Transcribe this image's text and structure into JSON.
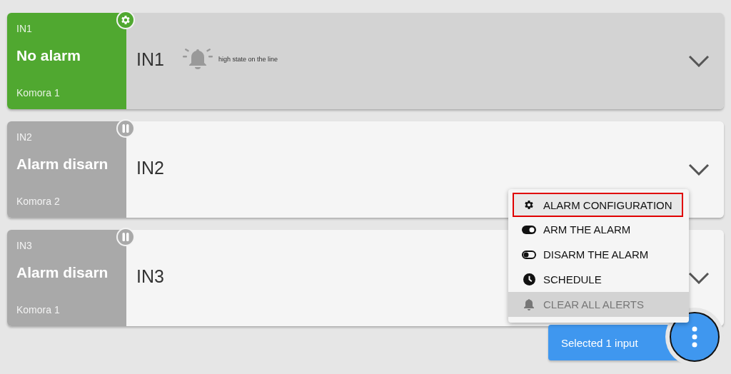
{
  "inputs": [
    {
      "code": "IN1",
      "status": "No alarm",
      "zone": "Komora 1",
      "name": "IN1",
      "disarmed": false,
      "selected": true,
      "note": "high state on the line"
    },
    {
      "code": "IN2",
      "status": "Alarm disarn",
      "zone": "Komora 2",
      "name": "IN2",
      "disarmed": true,
      "selected": false
    },
    {
      "code": "IN3",
      "status": "Alarm disarn",
      "zone": "Komora 1",
      "name": "IN3",
      "disarmed": true,
      "selected": false
    }
  ],
  "menu": {
    "items": [
      {
        "kind": "config",
        "label": "ALARM CONFIGURATION",
        "highlighted": true,
        "disabled": false
      },
      {
        "kind": "arm",
        "label": "ARM THE ALARM",
        "highlighted": false,
        "disabled": false
      },
      {
        "kind": "disarm",
        "label": "DISARM THE ALARM",
        "highlighted": false,
        "disabled": false
      },
      {
        "kind": "schedule",
        "label": "SCHEDULE",
        "highlighted": false,
        "disabled": false
      },
      {
        "kind": "clear",
        "label": "CLEAR ALL ALERTS",
        "highlighted": false,
        "disabled": true
      }
    ]
  },
  "selection": {
    "label": "Selected 1 input"
  }
}
